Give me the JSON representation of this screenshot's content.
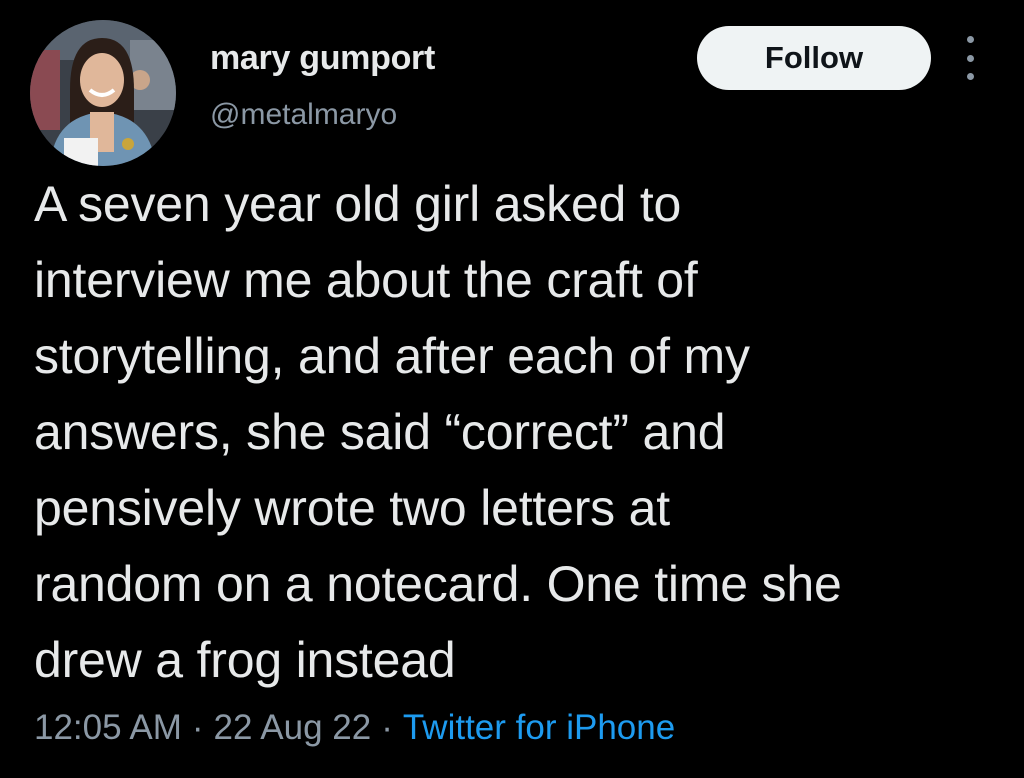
{
  "author": {
    "display_name": "mary gumport",
    "handle": "@metalmaryo",
    "avatar_icon": "profile-photo"
  },
  "actions": {
    "follow_label": "Follow",
    "more_icon": "more-vertical-icon"
  },
  "tweet": {
    "lines": [
      "A seven year old girl asked to",
      "interview me about the craft of",
      "storytelling, and after each of my",
      "answers, she said “correct” and",
      "pensively wrote two letters at",
      "random on a notecard. One time she",
      "drew a frog instead"
    ]
  },
  "meta": {
    "time": "12:05 AM",
    "separator": "·",
    "date": "22 Aug 22",
    "source": "Twitter for iPhone"
  },
  "colors": {
    "background": "#000000",
    "text": "#e7e9ea",
    "secondary_text": "#8b98a5",
    "link": "#1d9bf0",
    "follow_button_bg": "#eff3f4"
  }
}
